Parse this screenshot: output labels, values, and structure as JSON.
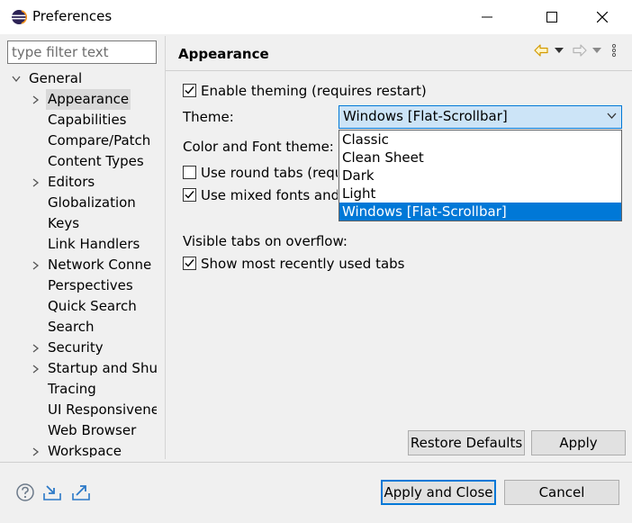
{
  "window": {
    "title": "Preferences"
  },
  "sidebar": {
    "filter_placeholder": "type filter text",
    "tree": [
      {
        "label": "General",
        "level": 0,
        "expanded": true
      },
      {
        "label": "Appearance",
        "level": 1,
        "has_children": true,
        "selected": true
      },
      {
        "label": "Capabilities",
        "level": 1,
        "has_children": false
      },
      {
        "label": "Compare/Patch",
        "level": 1,
        "has_children": false
      },
      {
        "label": "Content Types",
        "level": 1,
        "has_children": false
      },
      {
        "label": "Editors",
        "level": 1,
        "has_children": true
      },
      {
        "label": "Globalization",
        "level": 1,
        "has_children": false
      },
      {
        "label": "Keys",
        "level": 1,
        "has_children": false
      },
      {
        "label": "Link Handlers",
        "level": 1,
        "has_children": false
      },
      {
        "label": "Network Conne",
        "level": 1,
        "has_children": true
      },
      {
        "label": "Perspectives",
        "level": 1,
        "has_children": false
      },
      {
        "label": "Quick Search",
        "level": 1,
        "has_children": false
      },
      {
        "label": "Search",
        "level": 1,
        "has_children": false
      },
      {
        "label": "Security",
        "level": 1,
        "has_children": true
      },
      {
        "label": "Startup and Shu",
        "level": 1,
        "has_children": true
      },
      {
        "label": "Tracing",
        "level": 1,
        "has_children": false
      },
      {
        "label": "UI Responsivene",
        "level": 1,
        "has_children": false
      },
      {
        "label": "Web Browser",
        "level": 1,
        "has_children": false
      },
      {
        "label": "Workspace",
        "level": 1,
        "has_children": true
      }
    ]
  },
  "page": {
    "title": "Appearance",
    "enable_theming": {
      "label": "Enable theming (requires restart)",
      "checked": true
    },
    "theme_label": "Theme:",
    "theme_value": "Windows [Flat-Scrollbar]",
    "theme_options": [
      "Classic",
      "Clean Sheet",
      "Dark",
      "Light",
      "Windows [Flat-Scrollbar]"
    ],
    "theme_selected_index": 4,
    "color_font_label": "Color and Font theme:",
    "round_tabs": {
      "label": "Use round tabs (requ",
      "checked": false
    },
    "mixed_fonts": {
      "label": "Use mixed fonts and",
      "checked": true
    },
    "visible_tabs_label": "Visible tabs on overflow:",
    "show_mru": {
      "label": "Show most recently used tabs",
      "checked": true
    }
  },
  "buttons": {
    "restore_defaults": "Restore Defaults",
    "apply": "Apply",
    "apply_and_close": "Apply and Close",
    "cancel": "Cancel"
  },
  "icons": {
    "app": "eclipse-icon",
    "help": "help-icon",
    "import": "import-icon",
    "export": "export-icon",
    "back": "back-arrow-icon",
    "forward": "forward-arrow-icon",
    "menu": "view-menu-icon"
  },
  "colors": {
    "accent": "#0078d7",
    "selection_bg": "#d9d9d9",
    "combo_bg": "#cce4f7",
    "back_arrow": "#e8b000"
  }
}
